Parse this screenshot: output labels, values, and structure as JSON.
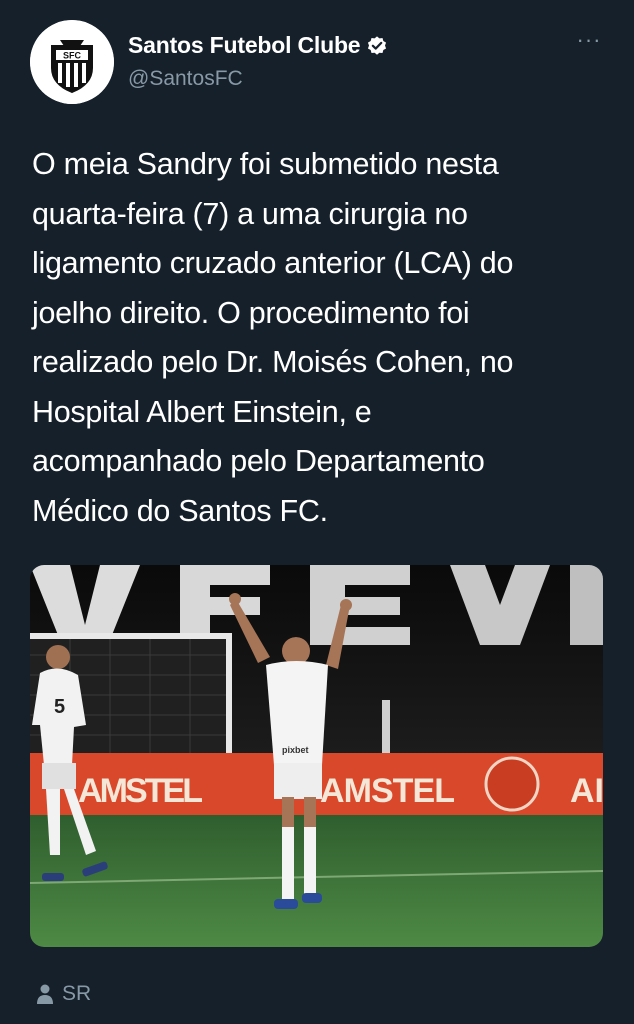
{
  "author": {
    "display_name": "Santos Futebol Clube",
    "handle": "@SantosFC",
    "verified": true,
    "avatar_icon": "santos-crest-icon",
    "crest_text": "SFC"
  },
  "menu": {
    "more_label": "···"
  },
  "tweet": {
    "lines": [
      "O meia Sandry foi submetido nesta",
      "quarta-feira (7) a uma cirurgia no",
      "ligamento cruzado anterior (LCA) do",
      "joelho direito. O procedimento foi",
      "realizado pelo Dr. Moisés Cohen, no",
      "Hospital Albert Einstein, e",
      "acompanhado pelo Departamento",
      "Médico do Santos FC."
    ]
  },
  "media": {
    "stadium_banner_text": "AMSTEL",
    "stadium_banner_text_2": "AMSTEL",
    "stadium_banner_text_3": "AI",
    "player_number": "5",
    "shirt_sponsor": "pixbet",
    "colors": {
      "banner": "#d9482a",
      "grass": "#3f7a3c",
      "stands": "#0e0e0e"
    }
  },
  "footer": {
    "credit": "SR",
    "icon": "person-icon"
  },
  "colors": {
    "background": "#15202b",
    "secondary_text": "#8899a6",
    "verified_badge": "#ffffff"
  }
}
